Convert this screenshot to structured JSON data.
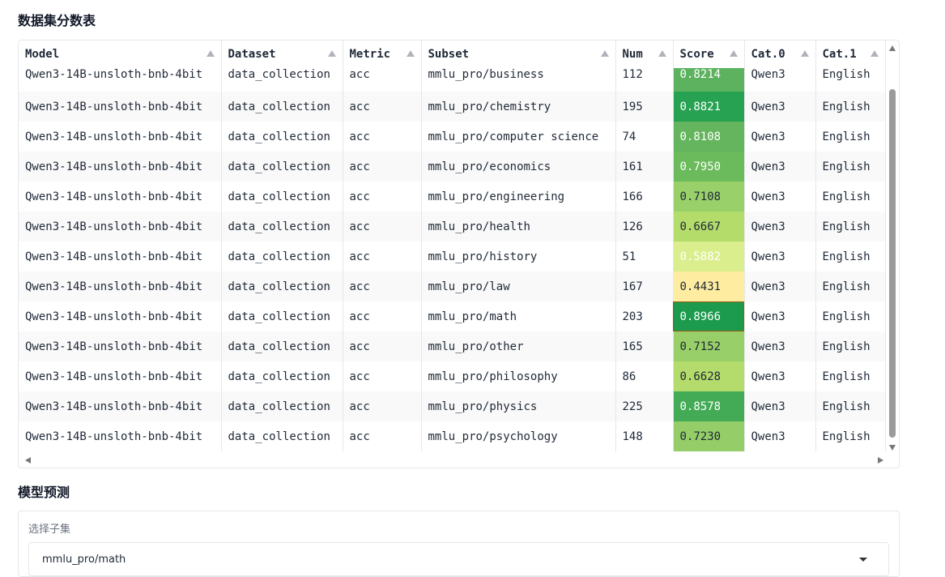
{
  "titles": {
    "score_table": "数据集分数表",
    "prediction": "模型预测"
  },
  "table": {
    "columns": [
      "Model",
      "Dataset",
      "Metric",
      "Subset",
      "Num",
      "Score",
      "Cat.0",
      "Cat.1"
    ],
    "rows": [
      [
        "Qwen3-14B-unsloth-bnb-4bit",
        "data_collection",
        "acc",
        "mmlu_pro/business",
        "112",
        "0.8214",
        "Qwen3",
        "English"
      ],
      [
        "Qwen3-14B-unsloth-bnb-4bit",
        "data_collection",
        "acc",
        "mmlu_pro/chemistry",
        "195",
        "0.8821",
        "Qwen3",
        "English"
      ],
      [
        "Qwen3-14B-unsloth-bnb-4bit",
        "data_collection",
        "acc",
        "mmlu_pro/computer science",
        "74",
        "0.8108",
        "Qwen3",
        "English"
      ],
      [
        "Qwen3-14B-unsloth-bnb-4bit",
        "data_collection",
        "acc",
        "mmlu_pro/economics",
        "161",
        "0.7950",
        "Qwen3",
        "English"
      ],
      [
        "Qwen3-14B-unsloth-bnb-4bit",
        "data_collection",
        "acc",
        "mmlu_pro/engineering",
        "166",
        "0.7108",
        "Qwen3",
        "English"
      ],
      [
        "Qwen3-14B-unsloth-bnb-4bit",
        "data_collection",
        "acc",
        "mmlu_pro/health",
        "126",
        "0.6667",
        "Qwen3",
        "English"
      ],
      [
        "Qwen3-14B-unsloth-bnb-4bit",
        "data_collection",
        "acc",
        "mmlu_pro/history",
        "51",
        "0.5882",
        "Qwen3",
        "English"
      ],
      [
        "Qwen3-14B-unsloth-bnb-4bit",
        "data_collection",
        "acc",
        "mmlu_pro/law",
        "167",
        "0.4431",
        "Qwen3",
        "English"
      ],
      [
        "Qwen3-14B-unsloth-bnb-4bit",
        "data_collection",
        "acc",
        "mmlu_pro/math",
        "203",
        "0.8966",
        "Qwen3",
        "English"
      ],
      [
        "Qwen3-14B-unsloth-bnb-4bit",
        "data_collection",
        "acc",
        "mmlu_pro/other",
        "165",
        "0.7152",
        "Qwen3",
        "English"
      ],
      [
        "Qwen3-14B-unsloth-bnb-4bit",
        "data_collection",
        "acc",
        "mmlu_pro/philosophy",
        "86",
        "0.6628",
        "Qwen3",
        "English"
      ],
      [
        "Qwen3-14B-unsloth-bnb-4bit",
        "data_collection",
        "acc",
        "mmlu_pro/physics",
        "225",
        "0.8578",
        "Qwen3",
        "English"
      ],
      [
        "Qwen3-14B-unsloth-bnb-4bit",
        "data_collection",
        "acc",
        "mmlu_pro/psychology",
        "148",
        "0.7230",
        "Qwen3",
        "English"
      ]
    ],
    "score_colors": [
      "#5db25f",
      "#27a152",
      "#64b55d",
      "#6bba5b",
      "#9ad06a",
      "#b3dc6b",
      "#dbee8d",
      "#feeca0",
      "#1c9a4e",
      "#98cf69",
      "#b4dc6c",
      "#43aa56",
      "#95cd68"
    ],
    "score_text_dark": [
      false,
      false,
      false,
      false,
      true,
      true,
      false,
      true,
      false,
      true,
      true,
      false,
      true
    ],
    "selected_row": 8
  },
  "prediction": {
    "select_label": "选择子集",
    "selected_subset": "mmlu_pro/math"
  }
}
